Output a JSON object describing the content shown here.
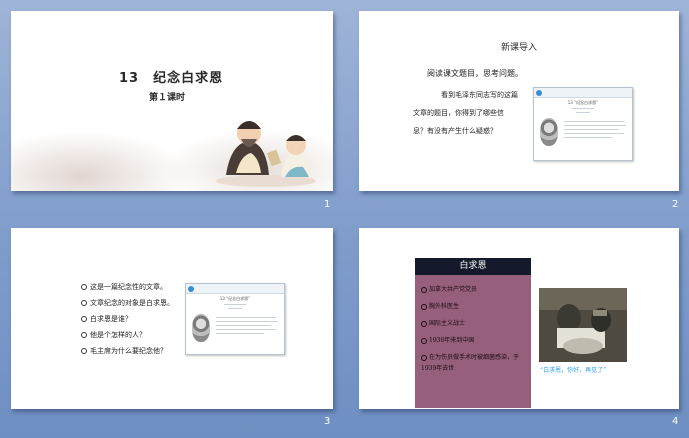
{
  "slides": [
    {
      "number": "1",
      "title": "13　纪念白求恩",
      "subtitle": "第１课时"
    },
    {
      "number": "2",
      "title": "新课导入",
      "lines": [
        "阅读课文题目，思考问题。",
        "看到毛泽东同志写的这篇",
        "文章的题目，你得到了哪些信",
        "息？有没有产生什么疑惑？"
      ],
      "card_title": "13 “纪念白求恩”"
    },
    {
      "number": "3",
      "bullets": [
        "这是一篇纪念性的文章。",
        "文章纪念的对象是白求恩。",
        "白求恩是谁？",
        "他是个怎样的人？",
        "毛主席为什么要纪念他？"
      ],
      "card_title": "13 “纪念白求恩”"
    },
    {
      "number": "4",
      "panel_title": "白求恩",
      "panel_items": [
        "加拿大共产党党员",
        "胸外科医生",
        "国际主义战士",
        "1938年来到中国",
        "在为伤员做手术时被细菌感染，于1939年去世"
      ],
      "photo_caption": "“白求恩，你好，再见了”"
    }
  ],
  "colors": {
    "background": "#8aa5d0",
    "panel": "#96607c",
    "panel_header": "#141a2c",
    "caption": "#2b9fe0"
  }
}
